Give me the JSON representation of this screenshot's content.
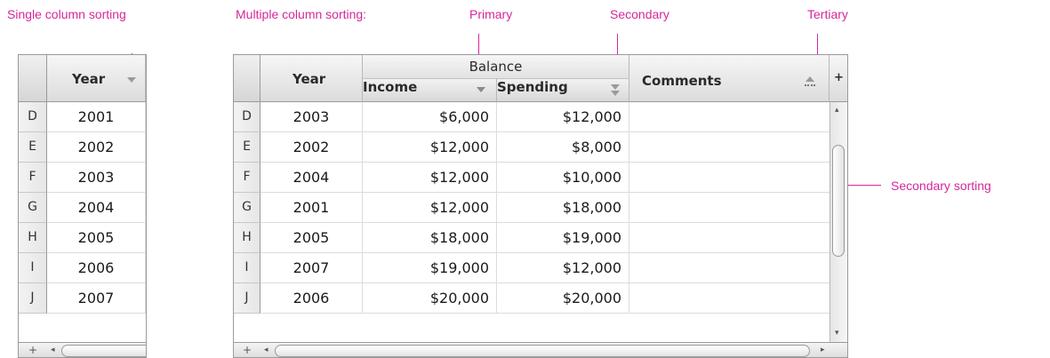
{
  "annotations": {
    "single": "Single column sorting",
    "multiple": "Multiple column sorting:",
    "primary": "Primary",
    "secondary": "Secondary",
    "tertiary": "Tertiary",
    "secondary_sorting": "Secondary sorting"
  },
  "single_table": {
    "header": "Year",
    "rows": [
      {
        "label": "D",
        "year": "2001"
      },
      {
        "label": "E",
        "year": "2002"
      },
      {
        "label": "F",
        "year": "2003"
      },
      {
        "label": "G",
        "year": "2004"
      },
      {
        "label": "H",
        "year": "2005"
      },
      {
        "label": "I",
        "year": "2006"
      },
      {
        "label": "J",
        "year": "2007"
      }
    ]
  },
  "multi_table": {
    "headers": {
      "year": "Year",
      "balance": "Balance",
      "income": "Income",
      "spending": "Spending",
      "comments": "Comments"
    },
    "rows": [
      {
        "label": "D",
        "year": "2003",
        "income": "$6,000",
        "spending": "$12,000",
        "comment": ""
      },
      {
        "label": "E",
        "year": "2002",
        "income": "$12,000",
        "spending": "$8,000",
        "comment": ""
      },
      {
        "label": "F",
        "year": "2004",
        "income": "$12,000",
        "spending": "$10,000",
        "comment": ""
      },
      {
        "label": "G",
        "year": "2001",
        "income": "$12,000",
        "spending": "$18,000",
        "comment": ""
      },
      {
        "label": "H",
        "year": "2005",
        "income": "$18,000",
        "spending": "$19,000",
        "comment": ""
      },
      {
        "label": "I",
        "year": "2007",
        "income": "$19,000",
        "spending": "$12,000",
        "comment": ""
      },
      {
        "label": "J",
        "year": "2006",
        "income": "$20,000",
        "spending": "$20,000",
        "comment": ""
      }
    ]
  },
  "icons": {
    "add": "+",
    "left": "◂",
    "right": "▸",
    "up": "▴",
    "down": "▾"
  },
  "colors": {
    "annotation": "#d6279b"
  }
}
